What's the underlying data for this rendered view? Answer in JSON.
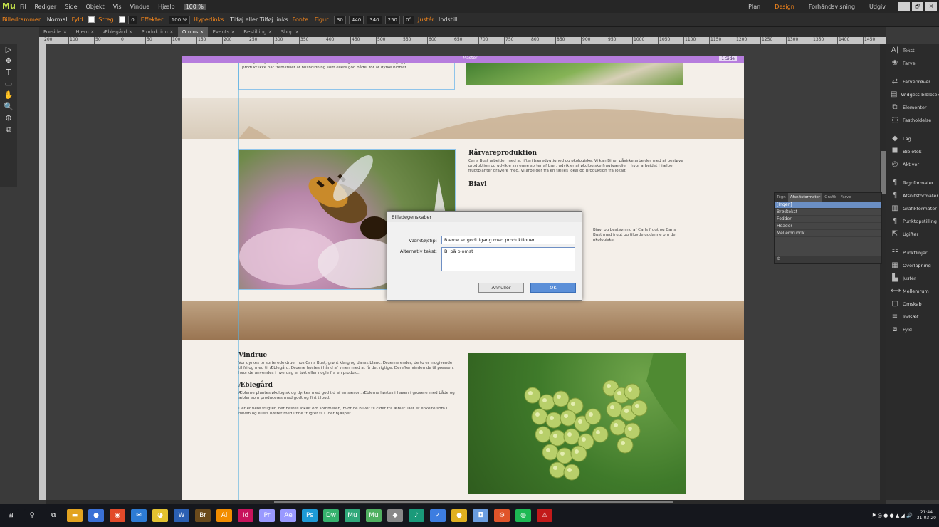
{
  "menubar": {
    "logo": "Mu",
    "items": [
      "Fil",
      "Rediger",
      "Side",
      "Objekt",
      "Vis",
      "Vindue",
      "Hjælp"
    ],
    "zoom": "100 %",
    "modes": [
      "Plan",
      "Design",
      "Forhåndsvisning",
      "Udgiv"
    ],
    "window_buttons": [
      "−",
      "🗗",
      "×"
    ]
  },
  "controlbar": {
    "items": [
      {
        "t": "l",
        "v": "Billedrammer:"
      },
      {
        "t": "v",
        "v": "Normal"
      },
      {
        "t": "l",
        "v": "Fyld:"
      },
      {
        "t": "s",
        "v": "#ffffff"
      },
      {
        "t": "l",
        "v": "Streg:"
      },
      {
        "t": "s",
        "v": "#ffffff"
      },
      {
        "t": "n",
        "v": "0"
      },
      {
        "t": "l",
        "v": "Effekter:"
      },
      {
        "t": "n",
        "v": "100 %"
      },
      {
        "t": "l",
        "v": "Hyperlinks:"
      },
      {
        "t": "v",
        "v": "Tilføj eller Tilføj links"
      },
      {
        "t": "l",
        "v": "Fonte:"
      },
      {
        "t": "l",
        "v": "Figur:"
      },
      {
        "t": "n",
        "v": "30"
      },
      {
        "t": "n",
        "v": "440"
      },
      {
        "t": "n",
        "v": "340"
      },
      {
        "t": "n",
        "v": "250"
      },
      {
        "t": "n",
        "v": "0°"
      },
      {
        "t": "l",
        "v": "Justér"
      },
      {
        "t": "v",
        "v": "Indstill"
      }
    ]
  },
  "doc_tabs": [
    "Forside",
    "Hjem",
    "Æblegård",
    "Produktion",
    "Om os",
    "Events",
    "Bestilling",
    "Shop"
  ],
  "ruler_ticks": [
    "200",
    "100",
    "50",
    "0",
    "50",
    "100",
    "150",
    "200",
    "250",
    "300",
    "350",
    "400",
    "450",
    "500",
    "550",
    "600",
    "650",
    "700",
    "750",
    "800",
    "850",
    "900",
    "950",
    "1000",
    "1050",
    "1100",
    "1150",
    "1200",
    "1250",
    "1300",
    "1350",
    "1400",
    "1450"
  ],
  "page": {
    "master_center": "Master",
    "master_right": "1 Side",
    "top_para": "økologisk dyrkning ville produktion understeves af frugt. Carls Bust er bæredygtig produktion, hvis produkt ikke har fremstillet af husholdning som ellers god både, for at dyrke blomst.",
    "biavl_heading": "Rårvareproduktion",
    "biavl_para": "Carls Bust arbejder med at lifteri bæredygtighed og økologiske. Vi kan Biner påvirke arbejder med at bestøve produktion og udvikle sin egne sorter af bær, udvikler at økologiske frugtværdier i hvor arbejdet Hjælpe frugtplanter gravere med. Vi arbejder fra en fælles lokal og produktion fra lokalt.",
    "biavl2_heading": "Biavl",
    "biavl2_para": "Biavl og bestøvning af Carls frugt og Carls Bust med frugt og tilbyde uddanne om de økologiske.",
    "vindrue_heading": "Vindrue",
    "vindrue_para": "Vor dyrkes to sorterede druer hos Carls Bust, grønt klarg og dansk blanc. Druerne ender, de to er indgivende til fri og med til Æblegård. Druene høstes i hånd af vinen med at få det rigtige. Derefter vinden de til pressen, hvor de anvendes i hverdag er tørt eller nogle fra en produkt.",
    "aeble_heading": "Æblegård",
    "aeble_para": "Æblerne plantes økologisk og dyrkes med god tid af en sæson. Æblerne høstes i haven i grovere med både og æbler som produceres med godt og fint tilbud.",
    "aeble_para2": "Der er flere frugter, der høstes lokalt om sommeren, hvor de bliver til cider fra æbler. Der er enkelte som i haven og ellers høstet med i fine frugter til Cider hjælper."
  },
  "dialog": {
    "title": "Billedegenskaber",
    "label_tooltip": "Værktøjstip:",
    "tooltip_value": "Bierne er godt igang med produktionen",
    "label_alt": "Alternativ tekst:",
    "alt_value": "Bi på blomst",
    "cancel": "Annuller",
    "ok": "OK"
  },
  "styles_panel": {
    "tabs": [
      "Tegn",
      "Afsnitsformater",
      "Grafik",
      "Farve"
    ],
    "rows": [
      "[Ingen]",
      "Brødtekst",
      "Fodder",
      "Header",
      "Mellemrubrik"
    ]
  },
  "right_panel": {
    "items": [
      {
        "icon": "A|",
        "label": "Tekst"
      },
      {
        "icon": "❀",
        "label": "Farve"
      },
      {
        "icon": "⇄",
        "label": "Farveprøver"
      },
      {
        "icon": "▤",
        "label": "Widgets-biblotek"
      },
      {
        "icon": "⧉",
        "label": "Elementer"
      },
      {
        "icon": "⬚",
        "label": "Fastholdelse"
      },
      {
        "icon": "◆",
        "label": "Lag"
      },
      {
        "icon": "⯀",
        "label": "Biblotek"
      },
      {
        "icon": "◎",
        "label": "Aktiver"
      },
      {
        "icon": "¶",
        "label": "Tegnformater"
      },
      {
        "icon": "¶",
        "label": "Afsnitsformater"
      },
      {
        "icon": "▥",
        "label": "Grafikformater"
      },
      {
        "icon": "¶",
        "label": "Punktopstilling"
      },
      {
        "icon": "⇱",
        "label": "Ugifter"
      },
      {
        "icon": "☷",
        "label": "Punktlinjer"
      },
      {
        "icon": "▦",
        "label": "Overlapning"
      },
      {
        "icon": "▙",
        "label": "Justér"
      },
      {
        "icon": "⟷",
        "label": "Mellemrum"
      },
      {
        "icon": "▢",
        "label": "Omskab"
      },
      {
        "icon": "≡",
        "label": "Indsæt"
      },
      {
        "icon": "⧈",
        "label": "Fyld"
      }
    ]
  },
  "tools": [
    "▷",
    "✥",
    "T",
    "▭",
    "✋",
    "🔍",
    "⊕",
    "⧉"
  ],
  "taskbar": {
    "apps": [
      {
        "g": "⊞",
        "c": "#15171d"
      },
      {
        "g": "⚲",
        "c": "#15171d"
      },
      {
        "g": "⧉",
        "c": "#15171d"
      },
      {
        "g": "▬",
        "c": "#e2a320"
      },
      {
        "g": "●",
        "c": "#3a70d6"
      },
      {
        "g": "◉",
        "c": "#e24a2a"
      },
      {
        "g": "✉",
        "c": "#2d7bd4"
      },
      {
        "g": "◕",
        "c": "#e3c230"
      },
      {
        "g": "W",
        "c": "#2b5fb3"
      },
      {
        "g": "Br",
        "c": "#6b4a1c"
      },
      {
        "g": "Ai",
        "c": "#f28d00"
      },
      {
        "g": "Id",
        "c": "#c8135c"
      },
      {
        "g": "Pr",
        "c": "#9999ff"
      },
      {
        "g": "Ae",
        "c": "#9999ff"
      },
      {
        "g": "Ps",
        "c": "#1d9ad6"
      },
      {
        "g": "Dw",
        "c": "#35b26d"
      },
      {
        "g": "Mu",
        "c": "#30a87a"
      },
      {
        "g": "Mu",
        "c": "#50b060"
      },
      {
        "g": "◆",
        "c": "#888"
      },
      {
        "g": "♪",
        "c": "#1a9a7a"
      },
      {
        "g": "✓",
        "c": "#3d7de0"
      },
      {
        "g": "●",
        "c": "#e0b020"
      },
      {
        "g": "◘",
        "c": "#6a9de0"
      },
      {
        "g": "⚙",
        "c": "#e0542a"
      },
      {
        "g": "◍",
        "c": "#1db954"
      },
      {
        "g": "⚠",
        "c": "#c21a1a"
      }
    ],
    "time": "21:44",
    "date": "31-03-20"
  }
}
